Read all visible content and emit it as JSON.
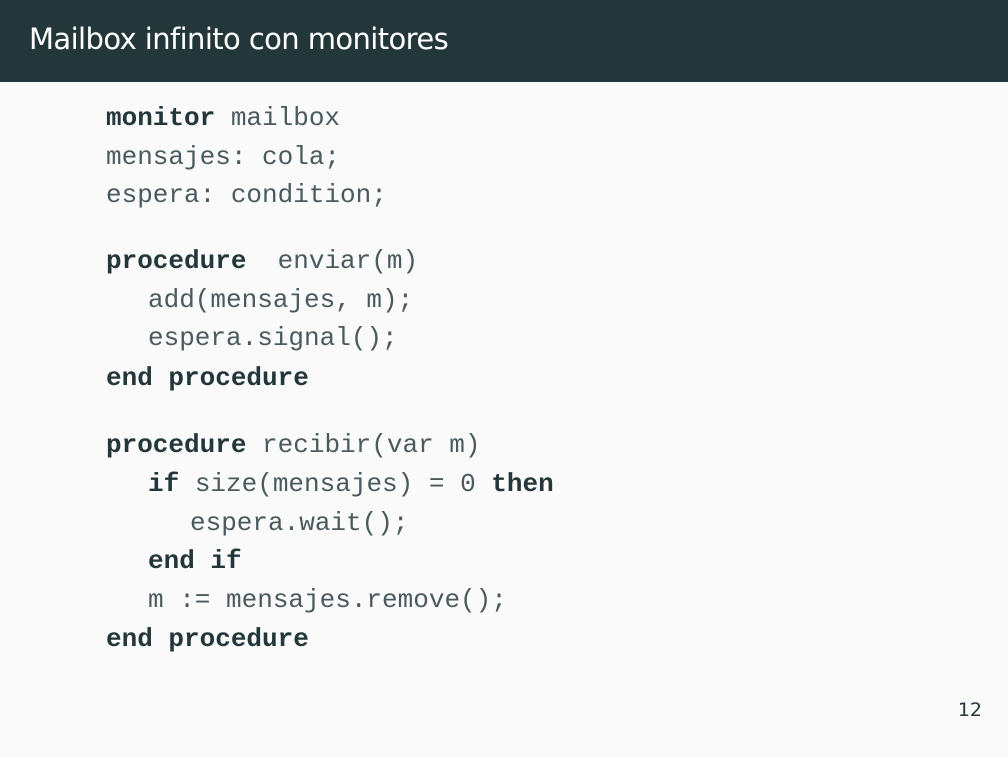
{
  "slide": {
    "title": "Mailbox infinito con monitores",
    "page_number": "12"
  },
  "code": {
    "line1_kw": "monitor",
    "line1_txt": " mailbox",
    "line2": "mensajes: cola;",
    "line3": "espera: condition;",
    "line4_kw": "procedure",
    "line4_txt": "  enviar(m)",
    "line5": "add(mensajes, m);",
    "line6": "espera.signal();",
    "line7_kw": "end procedure",
    "line8_kw": "procedure",
    "line8_txt": " recibir(var m)",
    "line9_kw1": "if",
    "line9_txt": " size(mensajes) = 0 ",
    "line9_kw2": "then",
    "line10": "espera.wait();",
    "line11_kw": "end if",
    "line12": "m := mensajes.remove();",
    "line13_kw": "end procedure"
  }
}
